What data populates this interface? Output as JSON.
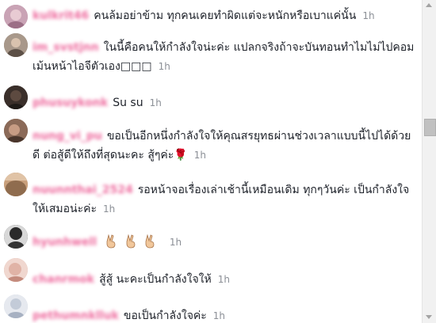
{
  "comments": [
    {
      "name": "kulkrit46",
      "text": "คนล้มอย่าข้าม ทุกคนเคยทำผิดแต่จะหนักหรือเบาแค่นั้น",
      "time": "1h",
      "avatar_color": "#c9a3b5"
    },
    {
      "name": "im_svstjnn",
      "text": "ในนี้คือคนให้กำลังใจน่ะค่ะ แปลกจริงถ้าจะบันทอนทำไมไม่ไปคอมเม้นหน้าไอจีตัวเอง□□□",
      "time": "1h",
      "avatar_color": "#8a7d70"
    },
    {
      "name": "phusuykonk",
      "text": "Su su",
      "time": "1h",
      "avatar_color": "#2f2a27"
    },
    {
      "name": "nung_vi_pu",
      "text": "ขอเป็นอีกหนึ่งกำลังใจให้คุณสรยุทธผ่านช่วงเวลาแบบนี้ไปได้ด้วยดี ต่อสู้ดีให้ถึงที่สุดนะคะ สู้ๆค่ะ",
      "emoji": "🌹",
      "time": "1h",
      "avatar_color": "#7a5c4c"
    },
    {
      "name": "nuunnthai_2524",
      "text": "รอหน้าจอเรื่องเล่าเช้านี้เหมือนเดิม ทุกๆวันค่ะ เป็นกำลังใจให้เสมอน่ะค่ะ",
      "emoji": "😊",
      "time": "1h",
      "avatar_color": "#b58f6a"
    },
    {
      "name": "hyunhwell",
      "text": "",
      "time": "1h",
      "avatar_color": "#3a3a3a"
    },
    {
      "name": "chanrmok",
      "text": "สู้สู้ นะคะเป็นกำลังใจให้",
      "time": "1h",
      "avatar_color": "#d9aba1"
    },
    {
      "name": "pethumnklluk",
      "text": "ขอเป็นกำลังใจค่ะ",
      "time": "1h",
      "avatar_color": "#c3cbd8"
    }
  ],
  "colors": {
    "username": "#ee6b9e",
    "timestamp": "#8b8f96",
    "text": "#1d2129"
  }
}
